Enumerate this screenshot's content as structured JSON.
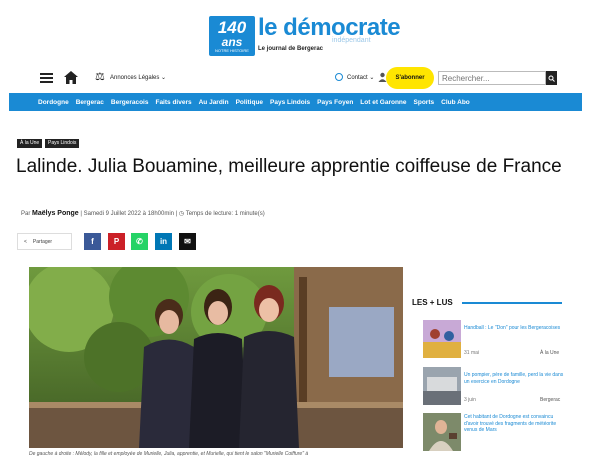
{
  "logo": {
    "badge_number": "140",
    "badge_word": "ans",
    "badge_small": "NOTRE HISTOIRE",
    "title": "le démocrate",
    "subtitle": "indépendant",
    "tagline": "Le journal de Bergerac"
  },
  "topbar": {
    "legal_label": "Annonces Légales ⌄",
    "contact_label": "Contact ⌄",
    "subscribe_label": "S'abonner",
    "search_placeholder": "Rechercher..."
  },
  "nav": {
    "items": [
      "Dordogne",
      "Bergerac",
      "Bergeracois",
      "Faits divers",
      "Au Jardin",
      "Politique",
      "Pays Lindois",
      "Pays Foyen",
      "Lot et Garonne",
      "Sports",
      "Club Abo"
    ]
  },
  "article": {
    "tags": [
      "À la Une",
      "Pays Lindois"
    ],
    "headline": "Lalinde. Julia Bouamine, meilleure apprentie coiffeuse de France",
    "by": "Par",
    "author": "Maëlys Ponge",
    "date": "Samedi 9 Juillet 2022 à 18h00min",
    "reading_time": "Temps de lecture: 1 minute(s)",
    "share_label": "Partager",
    "caption": "De gauche à droite : Mélody, la fille et employée de Murielle, Julia, apprentie, et Murielle, qui tient le salon \"Murielle Coiffure\" à"
  },
  "sidebar": {
    "title": "LES + LUS",
    "items": [
      {
        "title": "Handball : Le \"Don\" pour les Bergeracoises",
        "date": "31 mai",
        "category": "À la Une"
      },
      {
        "title": "Un pompier, père de famille, perd la vie dans un exercice en Dordogne",
        "date": "3 juin",
        "category": "Bergerac"
      },
      {
        "title": "Cet habitant de Dordogne est convaincu d'avoir trouvé des fragments de météorite venus de Mars",
        "date": "",
        "category": ""
      }
    ]
  },
  "colors": {
    "brand": "#1a8ad4",
    "subscribe": "#ffe500"
  }
}
